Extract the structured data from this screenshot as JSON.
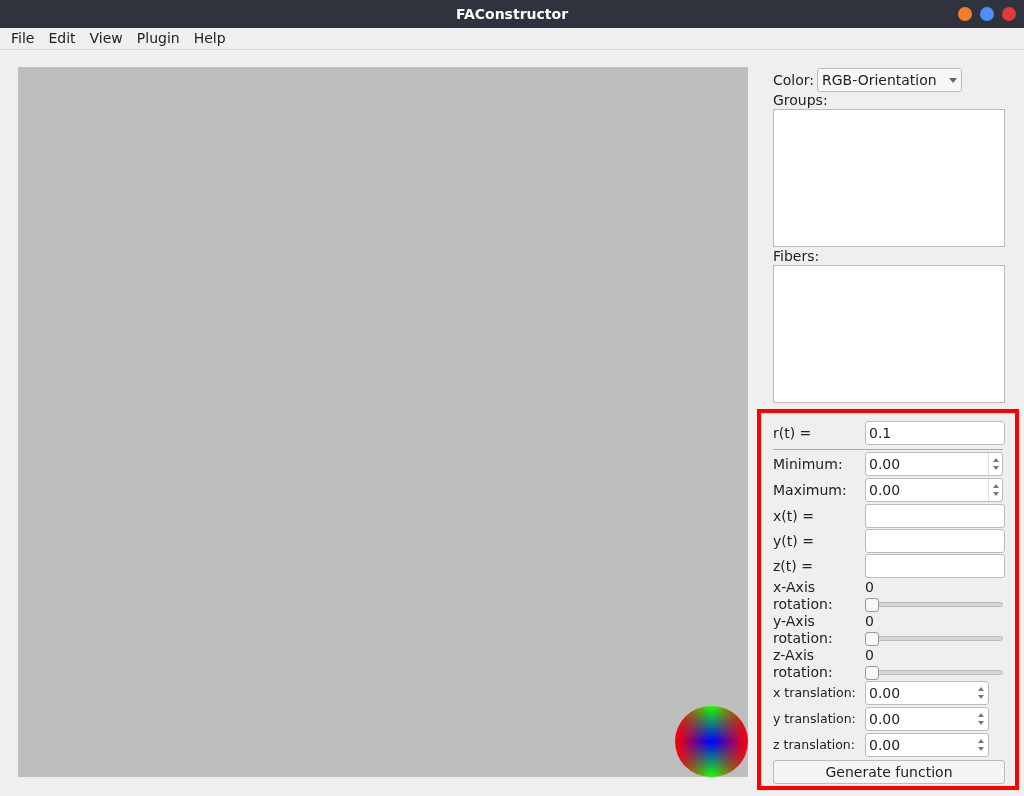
{
  "window": {
    "title": "FAConstructor"
  },
  "menu": [
    "File",
    "Edit",
    "View",
    "Plugin",
    "Help"
  ],
  "color": {
    "label": "Color:",
    "value": "RGB-Orientation"
  },
  "groups": {
    "label": "Groups:"
  },
  "fibers": {
    "label": "Fibers:"
  },
  "form": [
    {
      "kind": "text",
      "label": "r(t) =",
      "value": "0.1",
      "divider": true
    },
    {
      "kind": "spin",
      "label": "Minimum:",
      "value": "0.00"
    },
    {
      "kind": "spin",
      "label": "Maximum:",
      "value": "0.00"
    },
    {
      "kind": "text",
      "label": "x(t) ="
    },
    {
      "kind": "text",
      "label": "y(t) ="
    },
    {
      "kind": "text",
      "label": "z(t) ="
    },
    {
      "kind": "slider",
      "label": "x-Axis rotation:",
      "reading": "0",
      "level": 0
    },
    {
      "kind": "slider",
      "label": "y-Axis rotation:",
      "reading": "0",
      "level": 0
    },
    {
      "kind": "slider",
      "label": "z-Axis rotation:",
      "reading": "0",
      "level": 0
    },
    {
      "kind": "spin_short",
      "label": "x translation:",
      "value": "0.00"
    },
    {
      "kind": "spin_short",
      "label": "y translation:",
      "value": "0.00"
    },
    {
      "kind": "spin_short",
      "label": "z translation:",
      "value": "0.00"
    }
  ],
  "generate_button": "Generate function",
  "highlight": true
}
